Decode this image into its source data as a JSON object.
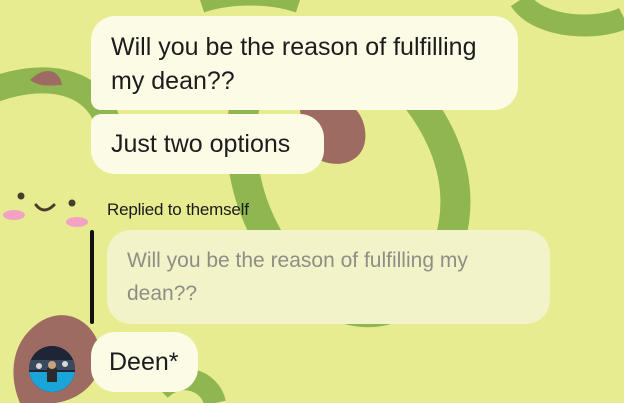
{
  "colors": {
    "background": "#e6ec8f",
    "avocado_outer": "#8fb650",
    "avocado_pit": "#9e6b63",
    "bubble": "#fbfbe6",
    "quote_bubble": "#f2f3c8"
  },
  "messages": [
    {
      "text": "Will you be the reason of fulfilling my dean??"
    },
    {
      "text": "Just two options"
    },
    {
      "reply_label": "Replied to themself",
      "quoted_text": "Will you be the reason of fulfilling my dean??",
      "text": "Deen*"
    }
  ],
  "sender": {
    "avatar_icon": "profile-photo"
  }
}
